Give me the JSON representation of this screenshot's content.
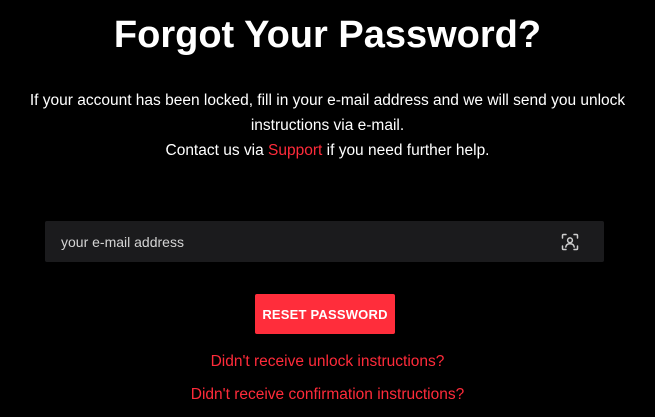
{
  "page": {
    "title": "Forgot Your Password?",
    "description_line1": "If your account has been locked, fill in your e-mail address and we will send you unlock",
    "description_line2": "instructions via e-mail.",
    "contact_prefix": "Contact us via ",
    "support_link": "Support",
    "contact_suffix": " if you need further help."
  },
  "form": {
    "email_placeholder": "your e-mail address",
    "email_value": "",
    "email_icon": "contact-card-icon",
    "submit_label": "RESET PASSWORD"
  },
  "links": {
    "unlock": "Didn't receive unlock instructions?",
    "confirmation": "Didn't receive confirmation instructions?"
  },
  "colors": {
    "background": "#000000",
    "accent": "#ff2d3b",
    "input_bg": "#1b1b1d",
    "text": "#ffffff"
  }
}
